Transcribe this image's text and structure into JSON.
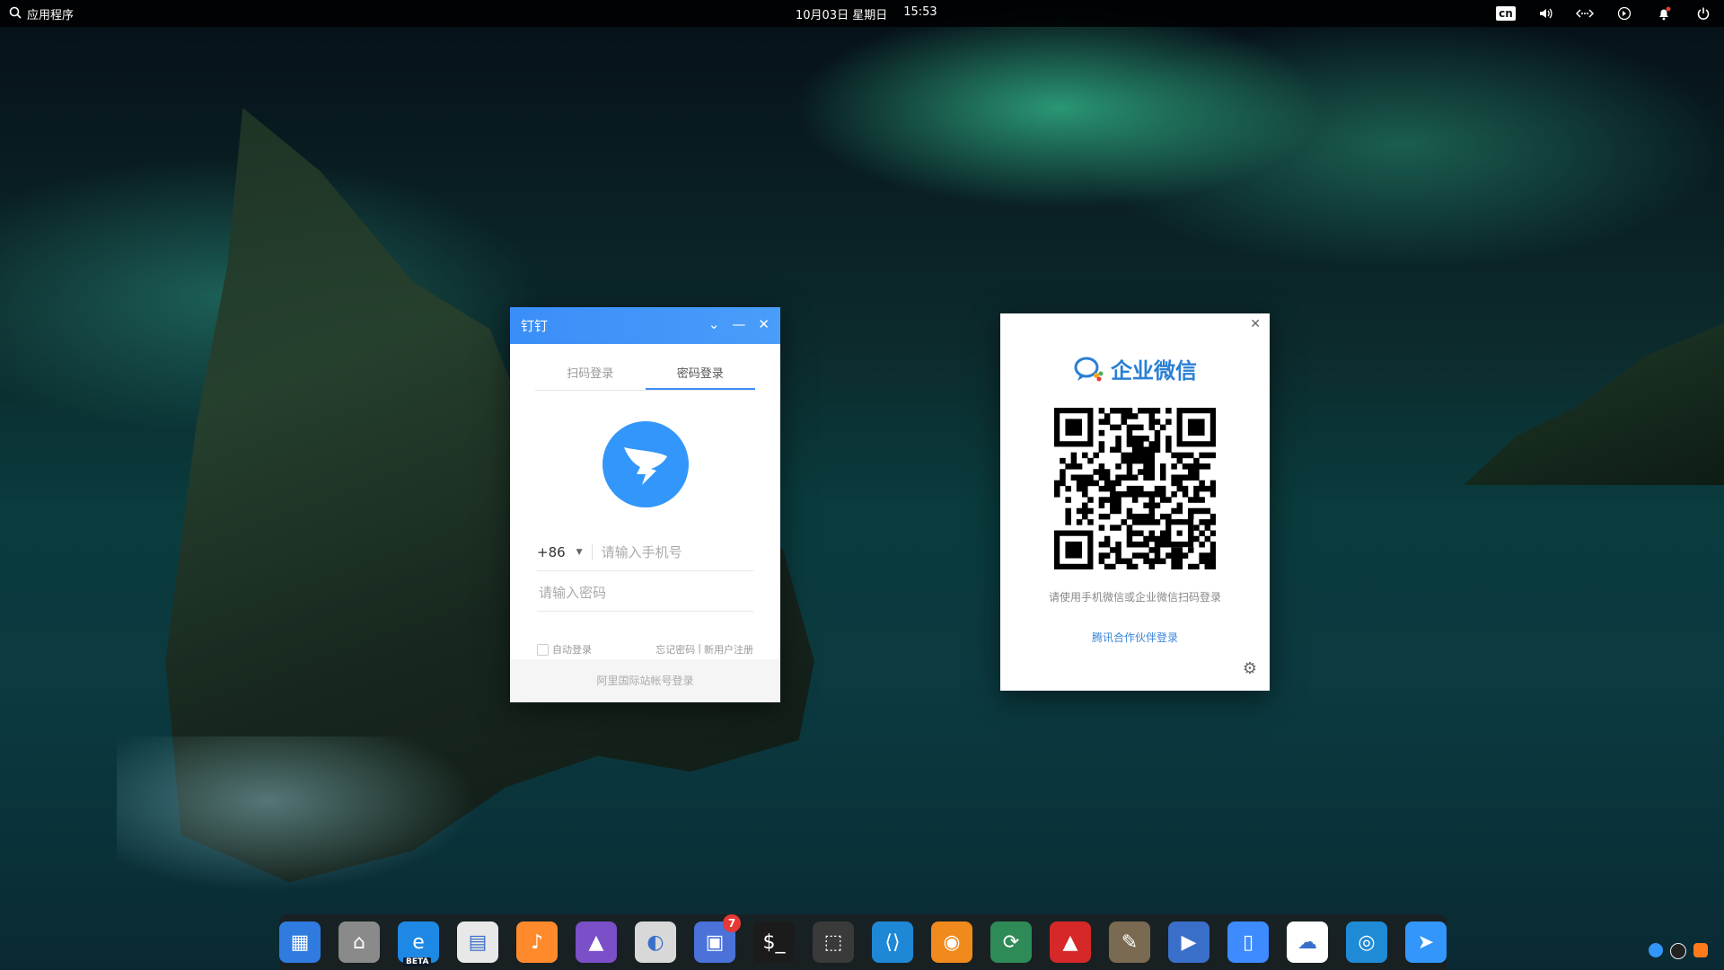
{
  "topbar": {
    "apps_label": "应用程序",
    "date": "10月03日 星期日",
    "time": "15:53",
    "input_method": "cn",
    "icons": [
      "volume-icon",
      "network-icon",
      "vpn-icon",
      "notification-icon",
      "power-icon"
    ]
  },
  "dingtalk": {
    "title": "钉钉",
    "tabs": [
      "扫码登录",
      "密码登录"
    ],
    "active_tab": "密码登录",
    "country_code": "+86",
    "phone_placeholder": "请输入手机号",
    "password_placeholder": "请输入密码",
    "auto_login": "自动登录",
    "forgot_password": "忘记密码",
    "separator": "|",
    "register": "新用户注册",
    "footer": "阿里国际站帐号登录",
    "accent": "#3a8ef8"
  },
  "wecom": {
    "brand": "企业微信",
    "hint": "请使用手机微信或企业微信扫码登录",
    "partner_login": "腾讯合作伙伴登录",
    "brand_color": "#2a7fd4"
  },
  "dock": {
    "items": [
      {
        "name": "multitasking-icon",
        "color": "#2f7be0"
      },
      {
        "name": "file-manager-icon",
        "color": "#8a8a8a"
      },
      {
        "name": "edge-beta-icon",
        "color": "#1e88e5",
        "badge_label": "BETA"
      },
      {
        "name": "calendar-icon",
        "color": "#e8e8e8"
      },
      {
        "name": "music-icon",
        "color": "#ff8a2b"
      },
      {
        "name": "image-viewer-icon",
        "color": "#7a4fc8"
      },
      {
        "name": "control-center-icon",
        "color": "#d8d8d8"
      },
      {
        "name": "app-store-icon",
        "color": "#4a72d9",
        "badge": "7"
      },
      {
        "name": "terminal-icon",
        "color": "#1b1b1b"
      },
      {
        "name": "screenshot-icon",
        "color": "#3a3a3a"
      },
      {
        "name": "vscode-icon",
        "color": "#1e88d6"
      },
      {
        "name": "blender-icon",
        "color": "#f08a1c"
      },
      {
        "name": "remote-desktop-icon",
        "color": "#2e8b57"
      },
      {
        "name": "red-arrow-icon",
        "color": "#d62828"
      },
      {
        "name": "gimp-icon",
        "color": "#7a6a52"
      },
      {
        "name": "media-player-icon",
        "color": "#3a6fc9"
      },
      {
        "name": "phone-assistant-icon",
        "color": "#3d8bff"
      },
      {
        "name": "baidu-netdisk-icon",
        "color": "#ffffff"
      },
      {
        "name": "wecom-dock-icon",
        "color": "#1f8ad6"
      },
      {
        "name": "dingtalk-dock-icon",
        "color": "#3296fa"
      }
    ]
  }
}
